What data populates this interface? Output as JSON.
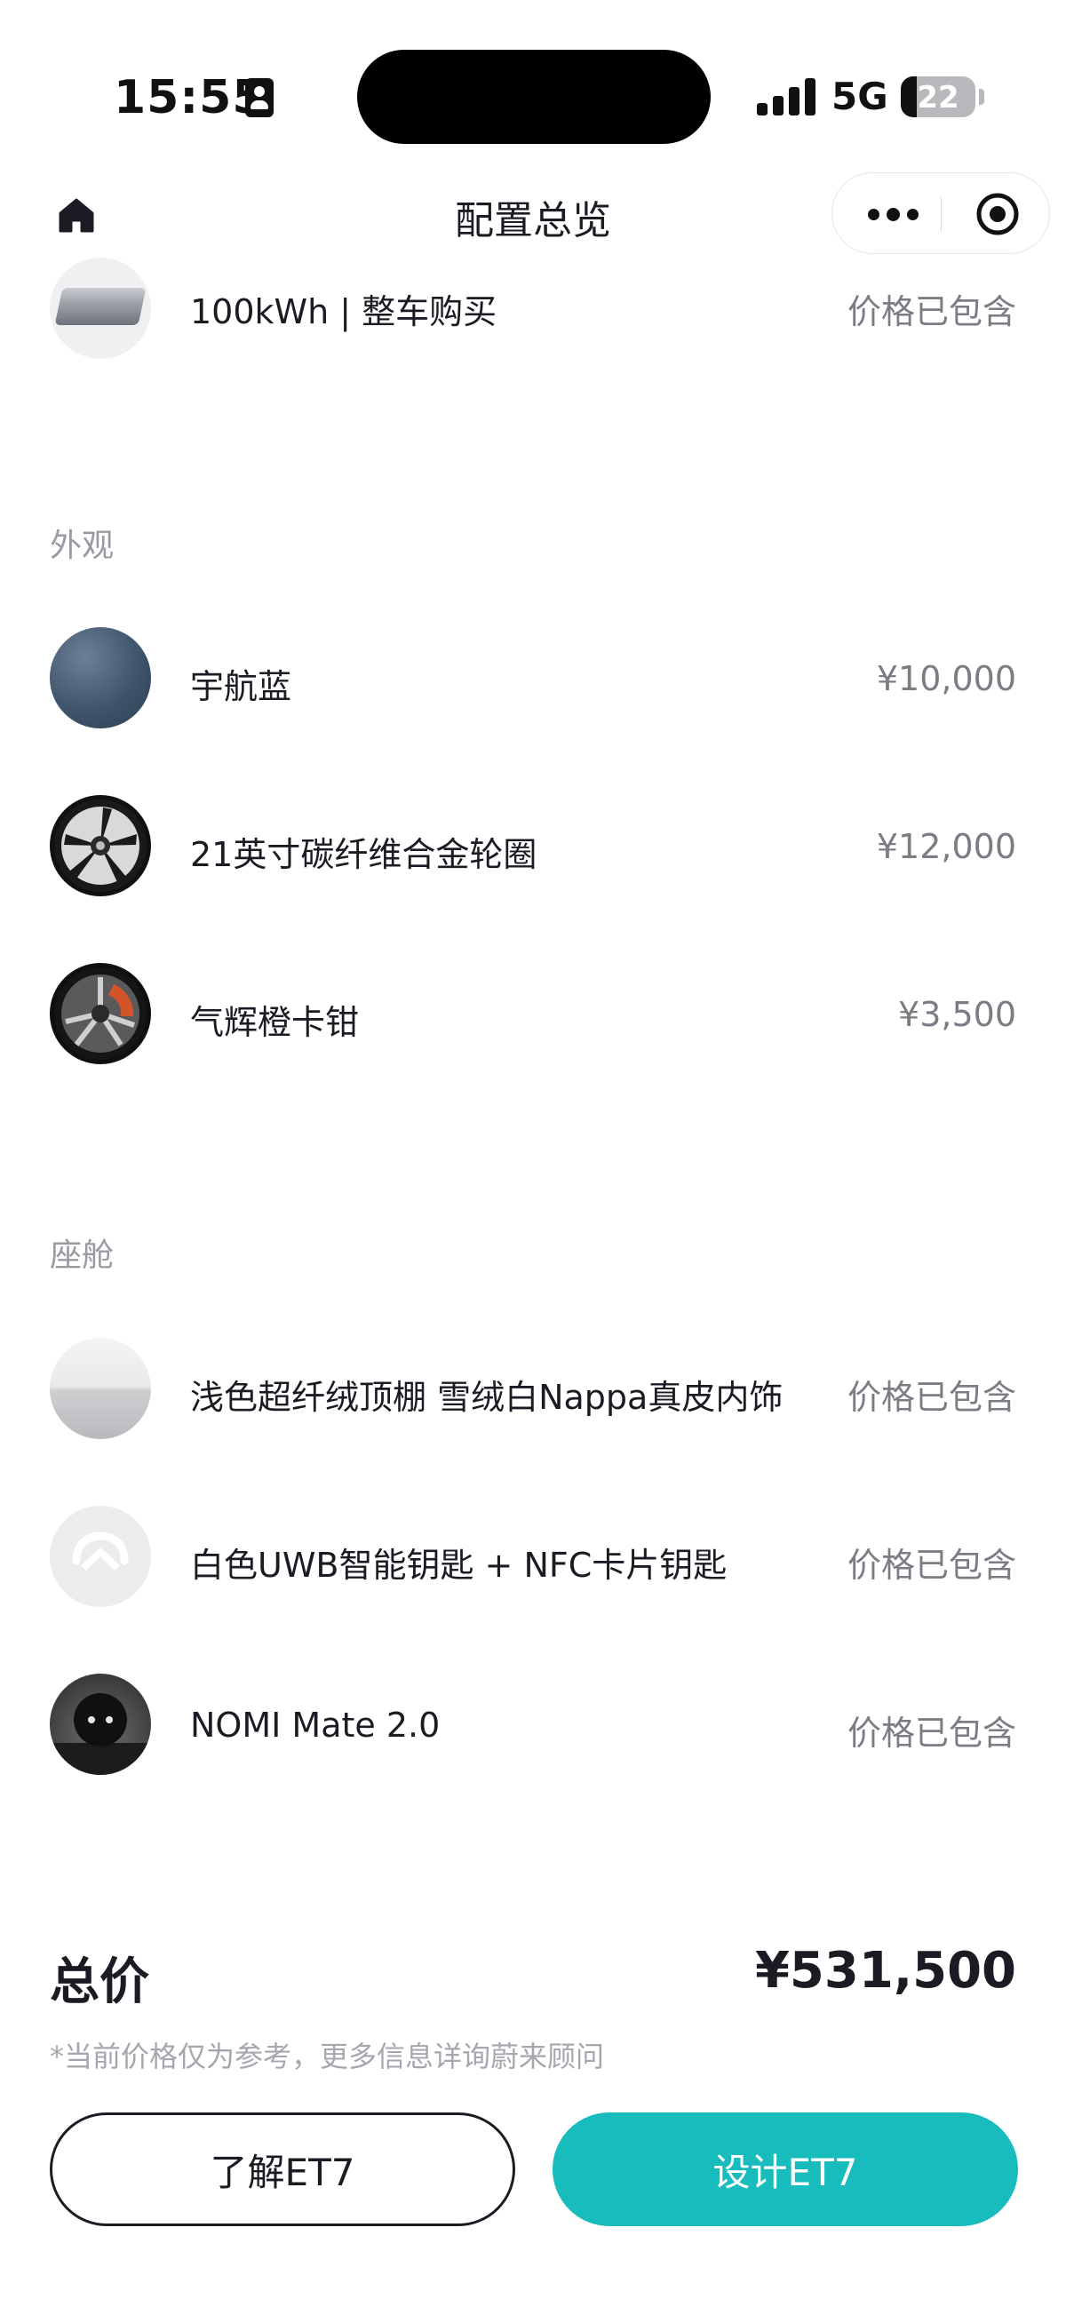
{
  "status_bar": {
    "time": "15:55",
    "network": "5G",
    "battery_level": "22",
    "battery_fraction": 0.22
  },
  "nav": {
    "title": "配置总览",
    "home_icon": "home-icon",
    "more_icon": "more-icon",
    "close_icon": "record-icon"
  },
  "battery_pack": {
    "name": "100kWh | 整车购买",
    "price": "价格已包含"
  },
  "sections": {
    "exterior": {
      "label": "外观",
      "items": [
        {
          "name": "宇航蓝",
          "price": "¥10,000"
        },
        {
          "name": "21英寸碳纤维合金轮圈",
          "price": "¥12,000"
        },
        {
          "name": "气辉橙卡钳",
          "price": "¥3,500"
        }
      ]
    },
    "cabin": {
      "label": "座舱",
      "items": [
        {
          "name": "浅色超纤绒顶棚 雪绒白Nappa真皮内饰",
          "price": "价格已包含"
        },
        {
          "name": "白色UWB智能钥匙 + NFC卡片钥匙",
          "price": "价格已包含"
        },
        {
          "name": "NOMI Mate 2.0",
          "price": "价格已包含"
        }
      ]
    }
  },
  "footer": {
    "total_label": "总价",
    "total_value": "¥531,500",
    "disclaimer": "*当前价格仅为参考，更多信息详询蔚来顾问",
    "learn_button": "了解ET7",
    "design_button": "设计ET7"
  },
  "colors": {
    "primary": "#18bcbc",
    "text": "#1b1b24",
    "muted": "#7b7c84"
  }
}
